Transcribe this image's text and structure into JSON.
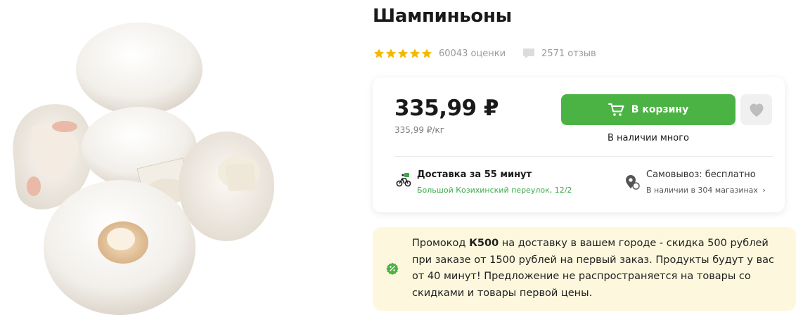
{
  "product": {
    "title": "Шампиньоны",
    "image_alt": "mushrooms-photo"
  },
  "rating": {
    "stars": 5,
    "ratings_label": "60043 оценки",
    "reviews_label": "2571 отзыв",
    "star_color": "#f5b800"
  },
  "buy": {
    "price": "335,99 ₽",
    "unit_price": "335,99 ₽/кг",
    "cart_button": "В корзину",
    "stock": "В наличии много",
    "accent_color": "#4bb344"
  },
  "delivery": {
    "title": "Доставка за 55 минут",
    "address": "Большой Козихинский переулок, 12/2"
  },
  "pickup": {
    "title": "Самовывоз: бесплатно",
    "stores": "В наличии в 304 магазинах",
    "chevron": "›"
  },
  "promo": {
    "prefix": "Промокод ",
    "code": "К500",
    "text": " на доставку в вашем городе - скидка 500 рублей при заказе от 1500 рублей на первый заказ. Продукты будут у вас от 40 минут! Предложение не распространяется на товары со скидками и товары первой цены.",
    "background": "#fdf7dd"
  }
}
